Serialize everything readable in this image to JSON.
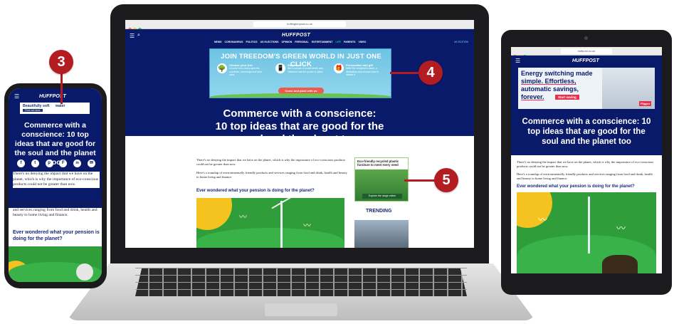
{
  "brand": "HUFFPOST",
  "headline": "Commerce with a conscience: 10 top ideas that are good for the soul and the planet too",
  "headline_lines": [
    "Commerce with a conscience:",
    "10 top ideas that are good for the",
    "soul and the planet too"
  ],
  "para1": "There's no denying the impact that we have on the planet, which is why the importance of eco-conscious products could not be greater than now.",
  "para2": "Here's a roundup of environmentally friendly products and services ranging from food and drink, health and beauty to home living and finance.",
  "subheading": "Ever wondered what your pension is doing for the planet?",
  "nav_items": [
    "NEWS",
    "CORONAVIRUS",
    "POLITICS",
    "US ELECTIONS",
    "OPINION",
    "PERSONAL",
    "ENTERTAINMENT",
    "LIFE",
    "PARENTS",
    "VIDEO"
  ],
  "nav_right": "UK EDITION",
  "laptop_url": "huffingtonpost.co.uk",
  "tablet_url": "huffpost.co.uk",
  "banner": {
    "title": "JOIN TREEDOM'S GREEN WORLD IN JUST ONE CLICK",
    "col1_title": "Choose your tree",
    "col1_text": "Choose from many species, countries, meanings and land uses",
    "col2_title": "Stay close",
    "col2_text": "We a unique of small seeds and Treedom has the power to plant",
    "col3_title": "Personalise and gift",
    "col3_text": "Write the recipient's name, a dedication and choose how to deliver it",
    "cta": "Come and plant with us"
  },
  "sidebar_ad": {
    "title": "Eco-friendly recycled plastic furniture to meet every need",
    "cta": "Explore the range online"
  },
  "trending": "TRENDING",
  "phone_ad": {
    "title": "Beautifully soft",
    "title_bold": "water",
    "cta": "Find out more"
  },
  "tablet_ad": {
    "line1": "Energy switching made",
    "line2": "simple. Effortless,",
    "line3": "automatic savings,",
    "line4": "forever.",
    "cta": "Start saving",
    "logo": "Flipper"
  },
  "markers": {
    "m3": "3",
    "m4": "4",
    "m5": "5"
  },
  "colors": {
    "navy": "#0a1a6b",
    "accent": "#b31d22",
    "green": "#2f9e3a",
    "huff_green": "#0dbe98"
  }
}
